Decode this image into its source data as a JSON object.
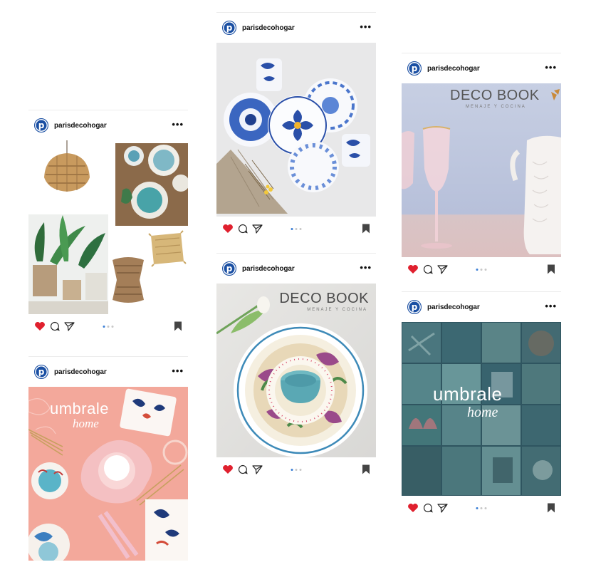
{
  "posts": [
    {
      "username": "parisdecohogar",
      "avatar_letter": "p",
      "more": "•••",
      "dots_active": 0
    },
    {
      "username": "parisdecohogar",
      "avatar_letter": "p",
      "more": "•••",
      "dots_active": 0
    },
    {
      "username": "parisdecohogar",
      "avatar_letter": "p",
      "more": "•••",
      "dots_active": 0,
      "brand_top": "umbrale",
      "brand_bottom": "home"
    },
    {
      "username": "parisdecohogar",
      "avatar_letter": "p",
      "more": "•••",
      "dots_active": 0,
      "title": "DECO BOOK",
      "subtitle": "MENAJE Y COCINA"
    },
    {
      "username": "parisdecohogar",
      "avatar_letter": "p",
      "more": "•••",
      "dots_active": 0,
      "title": "DECO BOOK",
      "subtitle": "MENAJE Y COCINA"
    },
    {
      "username": "parisdecohogar",
      "avatar_letter": "p",
      "more": "•••",
      "dots_active": 0,
      "brand_top": "umbrale",
      "brand_bottom": "home"
    }
  ],
  "colors": {
    "brand_blue": "#1a4fa3",
    "like_red": "#e0202e",
    "dot_active": "#3b7fd6",
    "dot_inactive": "#c8c8c8"
  },
  "icons": [
    "heart-icon",
    "comment-icon",
    "share-icon",
    "bookmark-icon"
  ]
}
